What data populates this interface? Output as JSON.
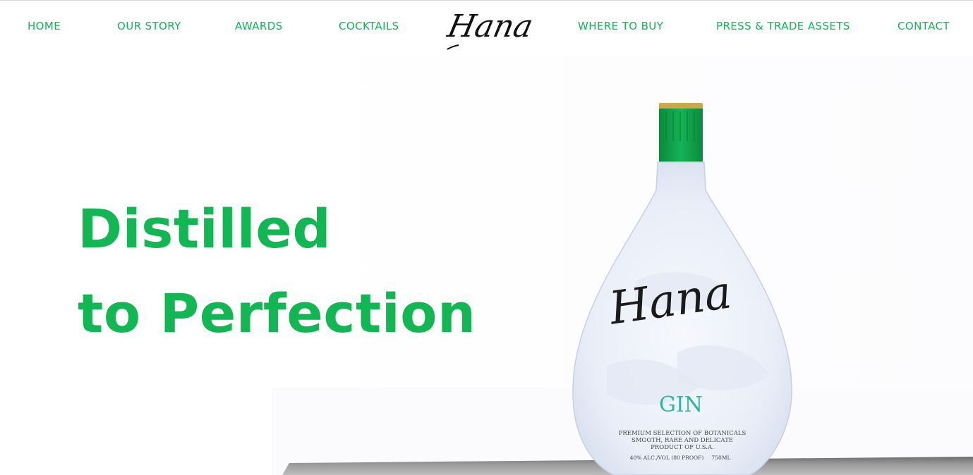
{
  "nav": {
    "left": [
      {
        "label": "HOME"
      },
      {
        "label": "OUR STORY"
      },
      {
        "label": "AWARDS"
      },
      {
        "label": "COCKTAILS"
      }
    ],
    "logo_text": "Hana",
    "right": [
      {
        "label": "WHERE TO BUY"
      },
      {
        "label": "PRESS & TRADE ASSETS"
      },
      {
        "label": "CONTACT"
      }
    ]
  },
  "hero": {
    "headline_line1": "Distilled",
    "headline_line2": "to Perfection",
    "bottle": {
      "brand": "Hana",
      "type": "GIN",
      "label_lines": [
        "PREMIUM SELECTION OF BOTANICALS",
        "SMOOTH, RARE AND DELICATE",
        "PRODUCT OF U.S.A."
      ],
      "abv": "40% ALC./VOL (80 PROOF)",
      "volume": "750ML"
    }
  },
  "colors": {
    "accent": "#12b754",
    "cap": "#0fa44a",
    "cap_rim": "#c9a94a",
    "gin_text": "#2fb5a0"
  }
}
